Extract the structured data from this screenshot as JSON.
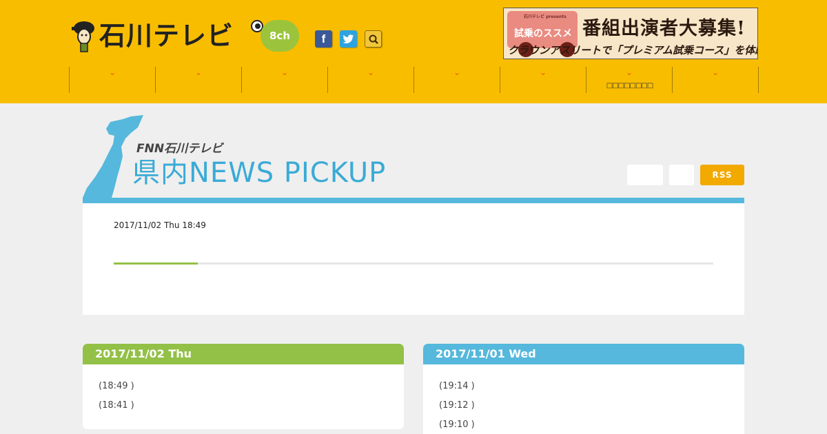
{
  "header": {
    "logo_text": "石川テレビ",
    "channel_badge": "8ch",
    "social": {
      "facebook": "f"
    },
    "banner": {
      "presents": "石川テレビ presents",
      "subtitle": "試乗のススメ",
      "title": "番組出演者大募集!",
      "bottom": "クラウンアスリートで「プレミアム試乗コース」を体験!"
    },
    "nav": [
      {
        "label": ""
      },
      {
        "label": ""
      },
      {
        "label": ""
      },
      {
        "label": ""
      },
      {
        "label": ""
      },
      {
        "label": ""
      },
      {
        "label": "□□□□□□□□"
      },
      {
        "label": ""
      }
    ]
  },
  "pickup": {
    "brand": "FNN石川テレビ",
    "title": "県内NEWS PICKUP",
    "rss_label": "RSS",
    "date": "2017/11/02 Thu 18:49",
    "progress": 0.14
  },
  "days": [
    {
      "date": "2017/11/02 Thu",
      "items": [
        "(18:49 )",
        "(18:41 )"
      ]
    },
    {
      "date": "2017/11/01 Wed",
      "items": [
        "(19:14 )",
        "(19:12 )",
        "(19:10 )"
      ]
    }
  ],
  "colors": {
    "header_bg": "#f9bd00",
    "accent_blue": "#55b8dc",
    "accent_green": "#93c047",
    "rss_orange": "#f2a900"
  }
}
